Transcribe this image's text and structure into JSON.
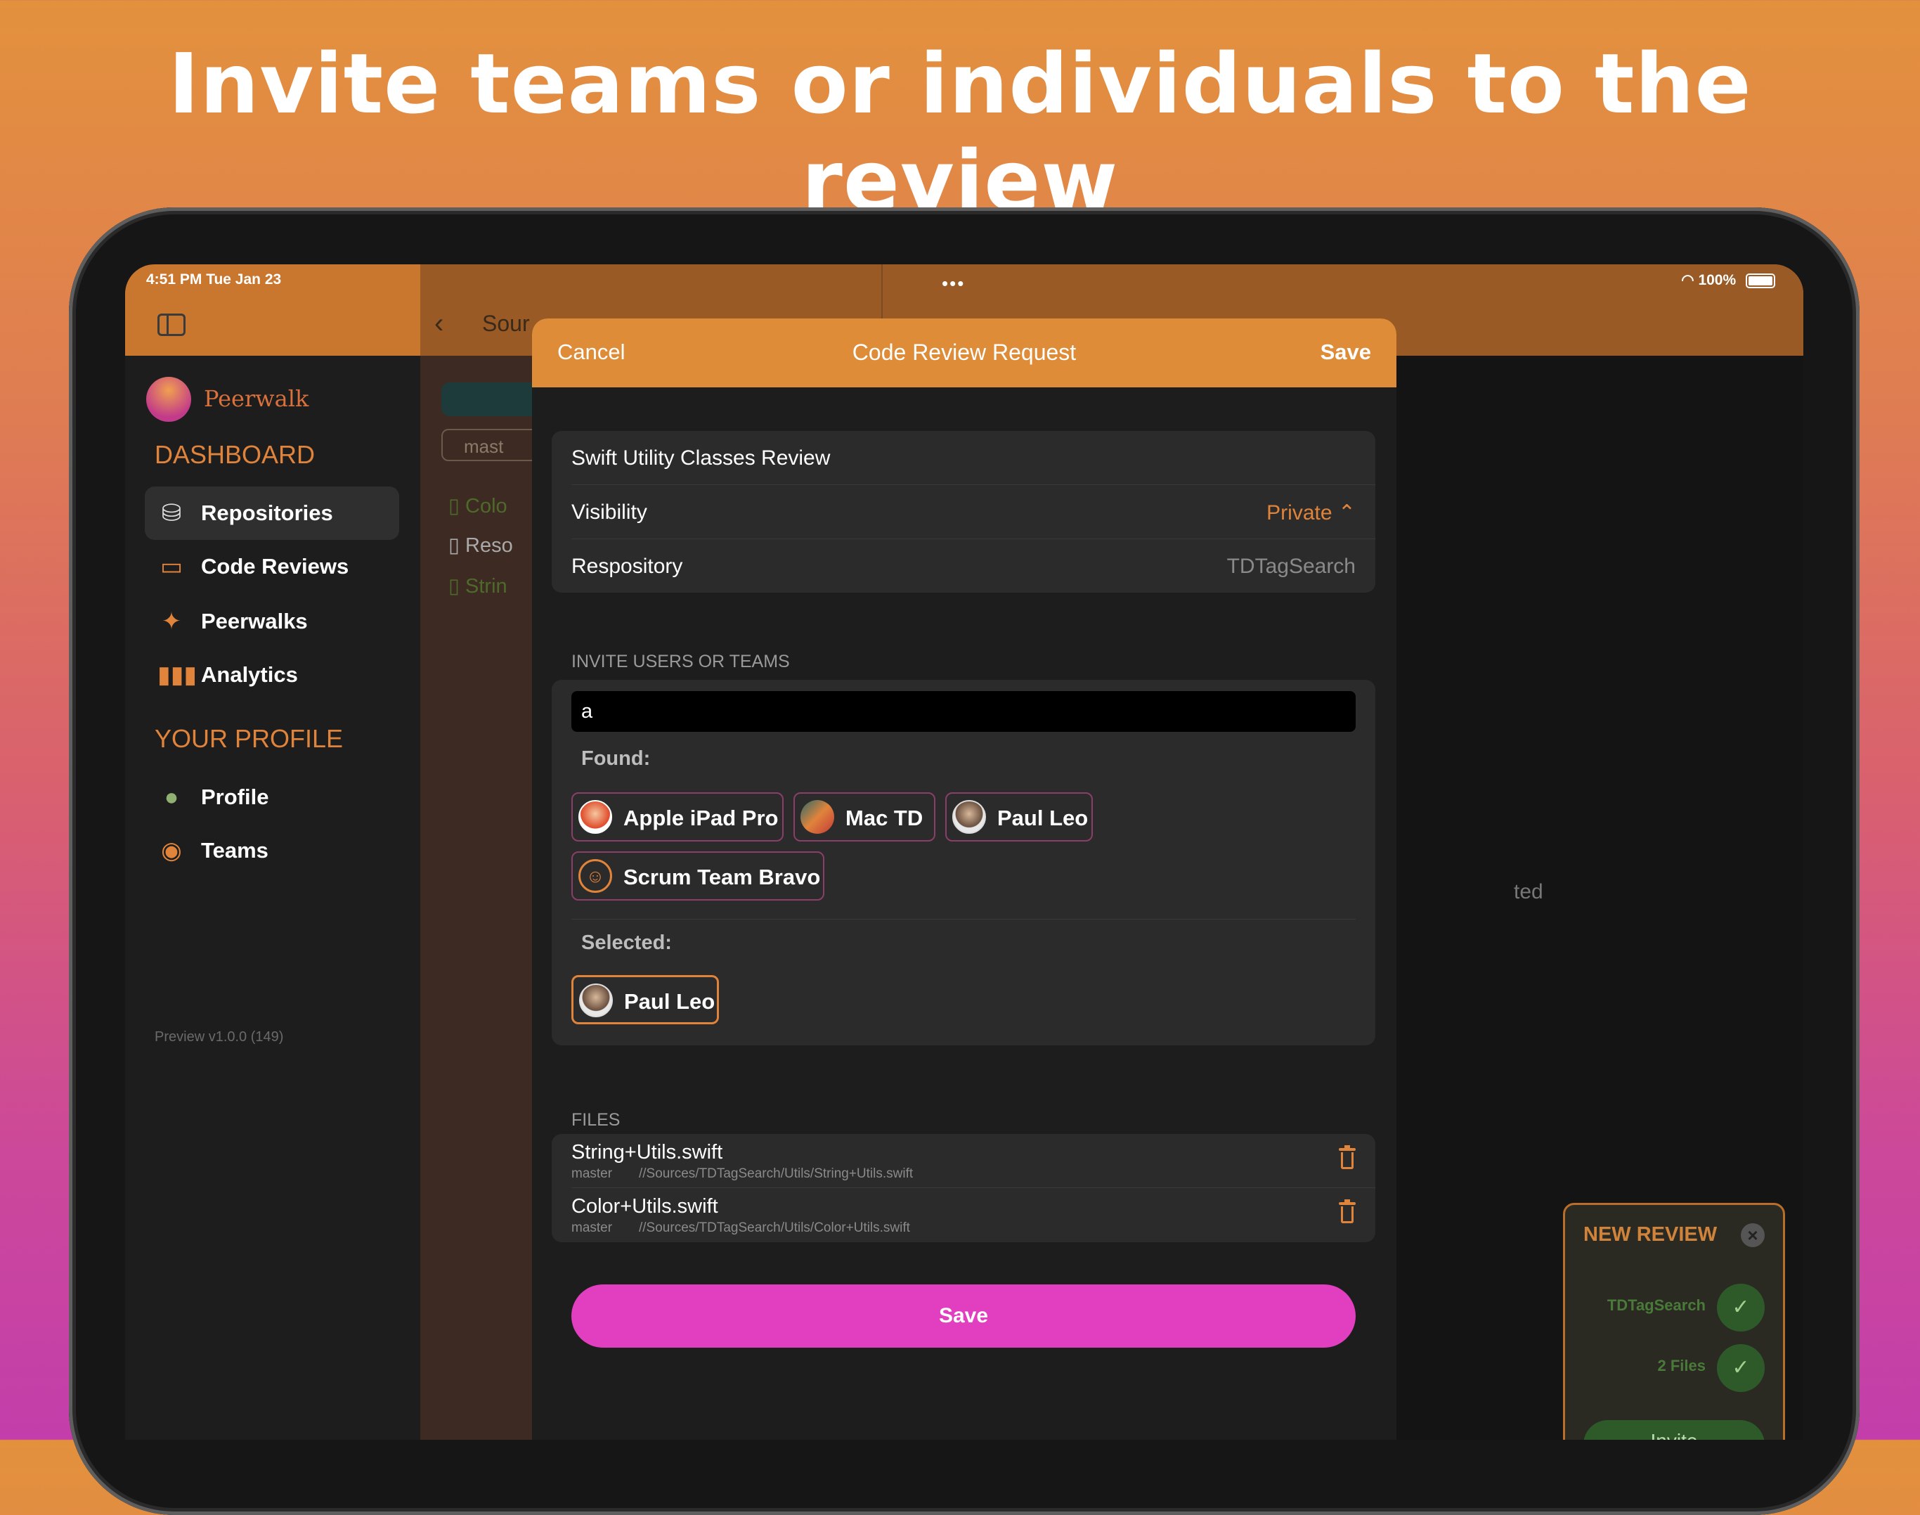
{
  "headline": "Invite teams or individuals to the review",
  "status_bar": {
    "time": "4:51 PM   Tue Jan 23",
    "battery": "100%"
  },
  "nav": {
    "breadcrumb": "Sour"
  },
  "sidebar": {
    "app_name": "Peerwalk",
    "dashboard_title": "DASHBOARD",
    "dashboard_items": [
      {
        "label": "Repositories",
        "icon": "database-icon"
      },
      {
        "label": "Code Reviews",
        "icon": "chat-icon"
      },
      {
        "label": "Peerwalks",
        "icon": "walk-icon"
      },
      {
        "label": "Analytics",
        "icon": "bar-chart-icon"
      }
    ],
    "profile_title": "YOUR PROFILE",
    "profile_items": [
      {
        "label": "Profile",
        "icon": "person-icon"
      },
      {
        "label": "Teams",
        "icon": "team-icon"
      }
    ],
    "version": "Preview v1.0.0 (149)"
  },
  "middle": {
    "branch": "mast",
    "files": [
      "Colo",
      "Reso",
      "Strin"
    ]
  },
  "detail": {
    "partial_text": "ted"
  },
  "new_review": {
    "title": "NEW REVIEW",
    "steps": [
      "TDTagSearch",
      "2 Files"
    ],
    "invite_label": "Invite"
  },
  "modal": {
    "cancel": "Cancel",
    "title": "Code Review Request",
    "save": "Save",
    "review_name": "Swift Utility Classes Review",
    "visibility_label": "Visibility",
    "visibility_value": "Private ⌃",
    "repository_label": "Respository",
    "repository_value": "TDTagSearch",
    "invite_caption": "INVITE USERS OR TEAMS",
    "search_value": "a",
    "found_label": "Found:",
    "found": [
      "Apple iPad Pro",
      "Mac TD",
      "Paul Leo",
      "Scrum Team Bravo"
    ],
    "selected_label": "Selected:",
    "selected": [
      "Paul Leo"
    ],
    "files_caption": "FILES",
    "files": [
      {
        "name": "String+Utils.swift",
        "branch": "master",
        "path": "//Sources/TDTagSearch/Utils/String+Utils.swift"
      },
      {
        "name": "Color+Utils.swift",
        "branch": "master",
        "path": "//Sources/TDTagSearch/Utils/Color+Utils.swift"
      }
    ],
    "save_button": "Save"
  },
  "colors": {
    "accent": "#de8c38",
    "save_button": "#e23fc0",
    "success": "#2e5a2a"
  }
}
